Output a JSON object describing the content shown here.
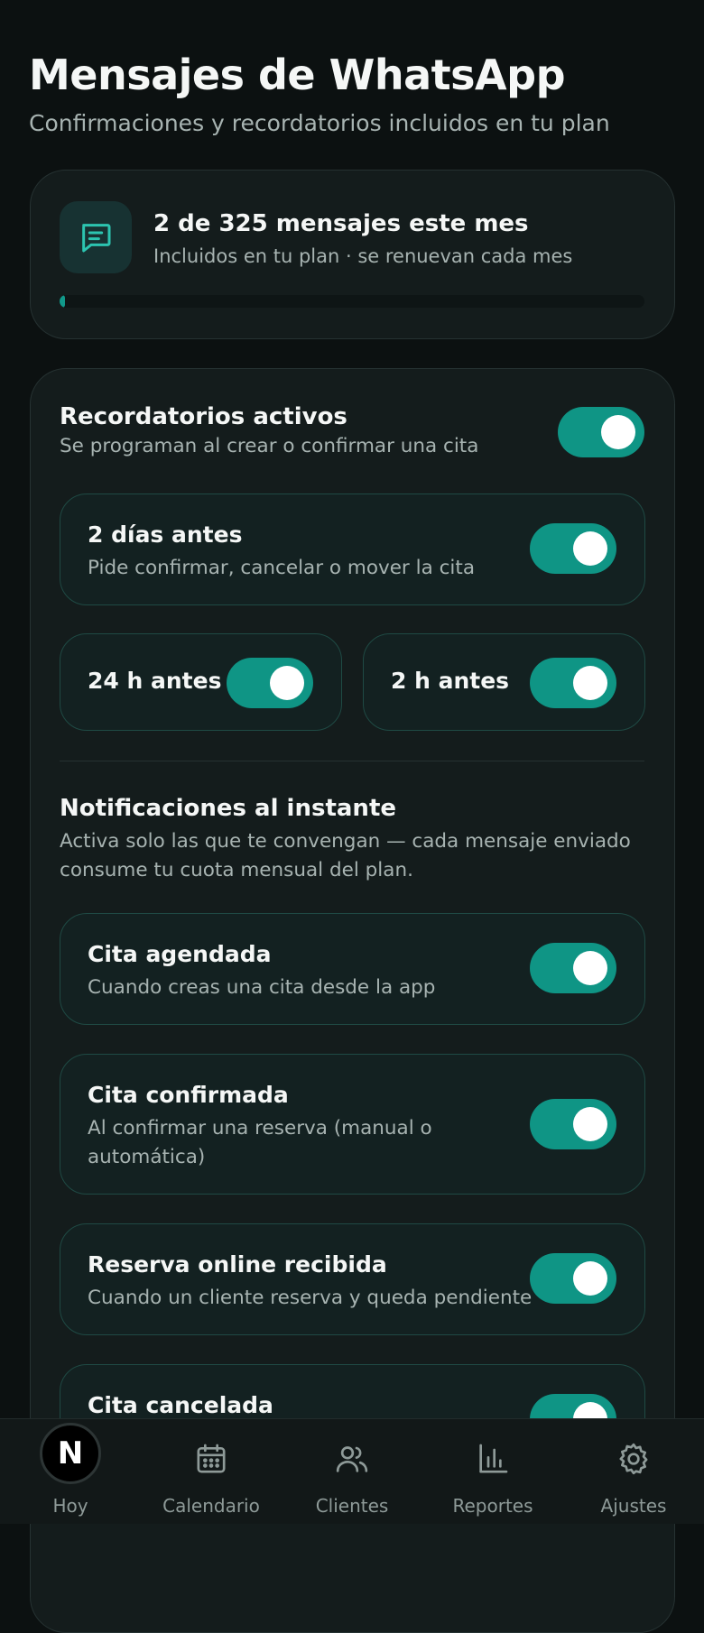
{
  "header": {
    "title": "Mensajes de WhatsApp",
    "subtitle": "Confirmaciones y recordatorios incluidos en tu plan"
  },
  "usage": {
    "icon": "message-icon",
    "title": "2 de 325 mensajes este mes",
    "subtitle": "Incluidos en tu plan · se renuevan cada mes",
    "used": 2,
    "limit": 325
  },
  "reminders": {
    "title": "Recordatorios activos",
    "subtitle": "Se programan al crear o confirmar una cita",
    "enabled": true,
    "two_days": {
      "title": "2 días antes",
      "desc": "Pide confirmar, cancelar o mover la cita",
      "enabled": true
    },
    "h24": {
      "title": "24 h antes",
      "enabled": true
    },
    "h2": {
      "title": "2 h antes",
      "enabled": true
    }
  },
  "instant": {
    "title": "Notificaciones al instante",
    "subtitle_line1": "Activa solo las que te convengan — cada mensaje enviado",
    "subtitle_line2": "consume tu cuota mensual del plan.",
    "items": [
      {
        "title": "Cita agendada",
        "desc_line1": "Cuando creas una cita desde la app",
        "desc_line2": "",
        "enabled": true
      },
      {
        "title": "Cita confirmada",
        "desc_line1": "Al confirmar una reserva (manual o",
        "desc_line2": "automática)",
        "enabled": true
      },
      {
        "title": "Reserva online recibida",
        "desc_line1": "Cuando un cliente reserva y queda pendiente",
        "desc_line2": "",
        "enabled": true
      },
      {
        "title": "Cita cancelada",
        "desc_line1": "",
        "desc_line2": "",
        "enabled": true
      }
    ]
  },
  "nav": {
    "items": [
      {
        "label": "Hoy",
        "icon": "home-logo-icon",
        "badge": "N"
      },
      {
        "label": "Calendario",
        "icon": "calendar-icon"
      },
      {
        "label": "Clientes",
        "icon": "users-icon"
      },
      {
        "label": "Reportes",
        "icon": "bar-chart-icon"
      },
      {
        "label": "Ajustes",
        "icon": "gear-icon"
      }
    ]
  },
  "colors": {
    "accent": "#0f9585",
    "background": "#0c1111",
    "card": "#141c1c"
  }
}
